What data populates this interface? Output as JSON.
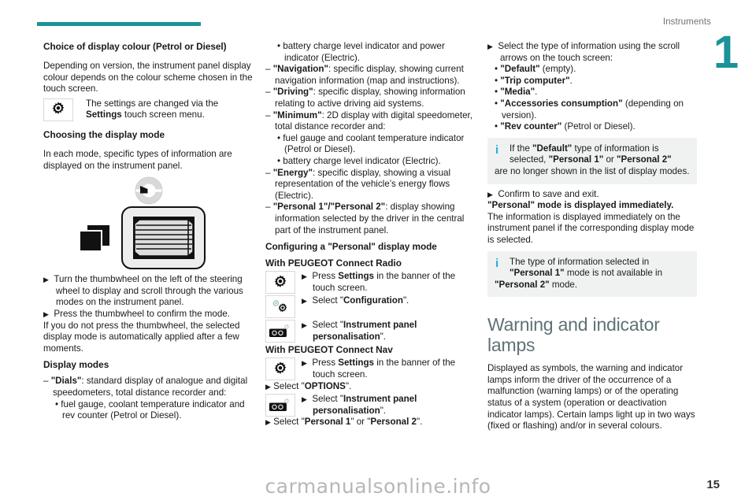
{
  "header": {
    "section_label": "Instruments",
    "chapter_number": "1"
  },
  "footer": {
    "page_number": "15",
    "watermark": "carmanualsonline.info"
  },
  "column1": {
    "heading_colour": "Choice of display colour (Petrol or Diesel)",
    "para_depending": "Depending on version, the instrument panel display colour depends on the colour scheme chosen in the touch screen.",
    "note_settings_pre": "The settings are changed via the ",
    "note_settings_bold": "Settings",
    "note_settings_post": " touch screen menu.",
    "heading_choosing": "Choosing the display mode",
    "para_each_mode": "In each mode, specific types of information are displayed on the instrument panel.",
    "action_turn": "Turn the thumbwheel on the left of the steering wheel to display and scroll through the various modes on the instrument panel.",
    "action_press": "Press the thumbwheel to confirm the mode.",
    "para_ifyoudonot": "If you do not press the thumbwheel, the selected display mode is automatically applied after a few moments.",
    "heading_display_modes": "Display modes",
    "dials_dash": "–",
    "dials_label": "\"Dials\"",
    "dials_text": ": standard display of analogue and digital speedometers, total distance recorder and:",
    "dials_bullet": "fuel gauge, coolant temperature indicator and rev counter (Petrol or Diesel)."
  },
  "column2": {
    "bullet_battery_power": "battery charge level indicator and power indicator (Electric).",
    "nav_dash": "–",
    "nav_label": "\"Navigation\"",
    "nav_text": ": specific display, showing current navigation information (map and instructions).",
    "driving_label": "\"Driving\"",
    "driving_text": ": specific display, showing information relating to active driving aid systems.",
    "minimum_label": "\"Minimum\"",
    "minimum_text": ": 2D display with digital speedometer, total distance recorder and:",
    "minimum_bullet1": "fuel gauge and coolant temperature indicator (Petrol or Diesel).",
    "minimum_bullet2": "battery charge level indicator (Electric).",
    "energy_label": "\"Energy\"",
    "energy_text": ": specific display, showing a visual representation of the vehicle’s energy flows (Electric).",
    "personal_label": "\"Personal 1\"/\"Personal 2\"",
    "personal_text": ": display showing information selected by the driver in the central part of the instrument panel.",
    "heading_configuring": "Configuring a \"Personal\" display mode",
    "heading_radio": "With PEUGEOT Connect Radio",
    "radio_step1_pre": "Press ",
    "radio_step1_bold": "Settings",
    "radio_step1_post": " in the banner of the touch screen.",
    "radio_step2_pre": "Select \"",
    "radio_step2_bold": "Configuration",
    "radio_step2_post": "\".",
    "radio_step3_pre": "Select \"",
    "radio_step3_bold": "Instrument panel personalisation",
    "radio_step3_post": "\".",
    "heading_nav": "With PEUGEOT Connect Nav",
    "nav_step1_pre": "Press ",
    "nav_step1_bold": "Settings",
    "nav_step1_post": " in the banner of the touch screen.",
    "nav_step2_pre": "Select \"",
    "nav_step2_bold": "OPTIONS",
    "nav_step2_post": "\".",
    "nav_step3_pre": "Select \"",
    "nav_step3_bold": "Instrument panel personalisation",
    "nav_step3_post": "\".",
    "nav_step4_pre": "Select \"",
    "nav_step4_bold1": "Personal 1",
    "nav_step4_mid": "\" or \"",
    "nav_step4_bold2": "Personal 2",
    "nav_step4_post": "\"."
  },
  "column3": {
    "action_select_type": "Select the type of information using the scroll arrows on the touch screen:",
    "opt_default_bold": "\"Default\"",
    "opt_default_rest": " (empty).",
    "opt_trip_bold": "\"Trip computer\"",
    "opt_trip_rest": ".",
    "opt_media_bold": "\"Media\"",
    "opt_media_rest": ".",
    "opt_access_bold": "\"Accessories consumption\"",
    "opt_access_rest": " (depending on version).",
    "opt_rev_bold": "\"Rev counter\"",
    "opt_rev_rest": " (Petrol or Diesel).",
    "note1_a": "If the ",
    "note1_b": "\"Default\"",
    "note1_c": " type of information is selected, ",
    "note1_d": "\"Personal 1\"",
    "note1_e": " or ",
    "note1_f": "\"Personal 2\"",
    "note1_tail": "are no longer shown in the list of display modes.",
    "action_confirm": "Confirm to save and exit.",
    "personal_immediate": "\"Personal\" mode is displayed immediately.",
    "para_info_displayed": "The information is displayed immediately on the instrument panel if the corresponding display mode is selected.",
    "note2_a": "The type of information selected in ",
    "note2_b": "\"Personal 1\"",
    "note2_c": " mode is not available in ",
    "note2_tail_bold": "\"Personal 2\"",
    "note2_tail_rest": " mode.",
    "section_heading": "Warning and indicator lamps",
    "para_displayed_symbols": "Displayed as symbols, the warning and indicator lamps inform the driver of the occurrence of a malfunction (warning lamps) or of the operating status of a system (operation or deactivation indicator lamps). Certain lamps light up in two ways (fixed or flashing) and/or in several colours."
  },
  "colors": {
    "accent_teal": "#1b9398",
    "section_heading": "#5f7275",
    "note_bg": "#f0f2f2",
    "info_icon": "#29abe2"
  },
  "icons": {
    "gear": "gear-icon",
    "double_gear": "double-gear-icon",
    "instrument_panel": "instrument-panel-gear-icon",
    "info": "info-i-icon",
    "arrow": "triangle-right-arrow"
  }
}
